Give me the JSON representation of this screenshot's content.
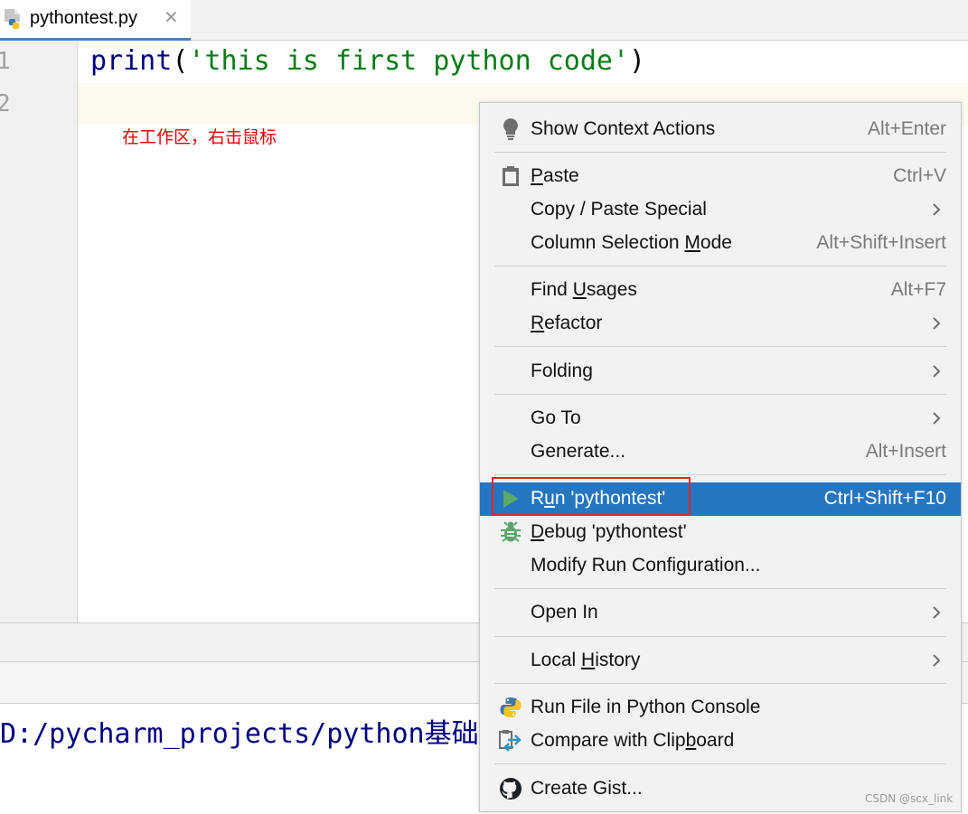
{
  "tab": {
    "file_name": "pythontest.py",
    "close_glyph": "✕",
    "icon": "python-file-icon"
  },
  "editor": {
    "line_numbers": [
      "1",
      "2"
    ],
    "code": {
      "fn": "print",
      "open": "(",
      "string": "'this is first python code'",
      "close": ")"
    },
    "annotation": "在工作区，右击鼠标"
  },
  "console": {
    "path_text": "D:/pycharm_projects/python基础"
  },
  "menu": {
    "items": [
      {
        "label": "Show Context Actions",
        "shortcut": "Alt+Enter",
        "icon": "lightbulb-icon"
      },
      {
        "label": "Paste",
        "shortcut": "Ctrl+V",
        "icon": "clipboard-icon",
        "mnemonic": "P"
      },
      {
        "label": "Copy / Paste Special",
        "submenu": true
      },
      {
        "label": "Column Selection Mode",
        "shortcut": "Alt+Shift+Insert",
        "mnemonic": "M"
      },
      {
        "label": "Find Usages",
        "shortcut": "Alt+F7",
        "mnemonic": "U"
      },
      {
        "label": "Refactor",
        "submenu": true,
        "mnemonic": "R"
      },
      {
        "label": "Folding",
        "submenu": true
      },
      {
        "label": "Go To",
        "submenu": true
      },
      {
        "label": "Generate...",
        "shortcut": "Alt+Insert"
      },
      {
        "label": "Run 'pythontest'",
        "shortcut": "Ctrl+Shift+F10",
        "icon": "run-icon",
        "mnemonic": "u",
        "highlighted": true
      },
      {
        "label": "Debug 'pythontest'",
        "icon": "debug-icon",
        "mnemonic": "D"
      },
      {
        "label": "Modify Run Configuration..."
      },
      {
        "label": "Open In",
        "submenu": true
      },
      {
        "label": "Local History",
        "submenu": true,
        "mnemonic": "H"
      },
      {
        "label": "Run File in Python Console",
        "icon": "python-icon"
      },
      {
        "label": "Compare with Clipboard",
        "icon": "compare-icon",
        "mnemonic": "b"
      },
      {
        "label": "Create Gist...",
        "icon": "github-icon"
      }
    ],
    "highlight_color": "#2675bf",
    "annotation_box_color": "#e0262c"
  },
  "watermark": "CSDN @scx_link"
}
